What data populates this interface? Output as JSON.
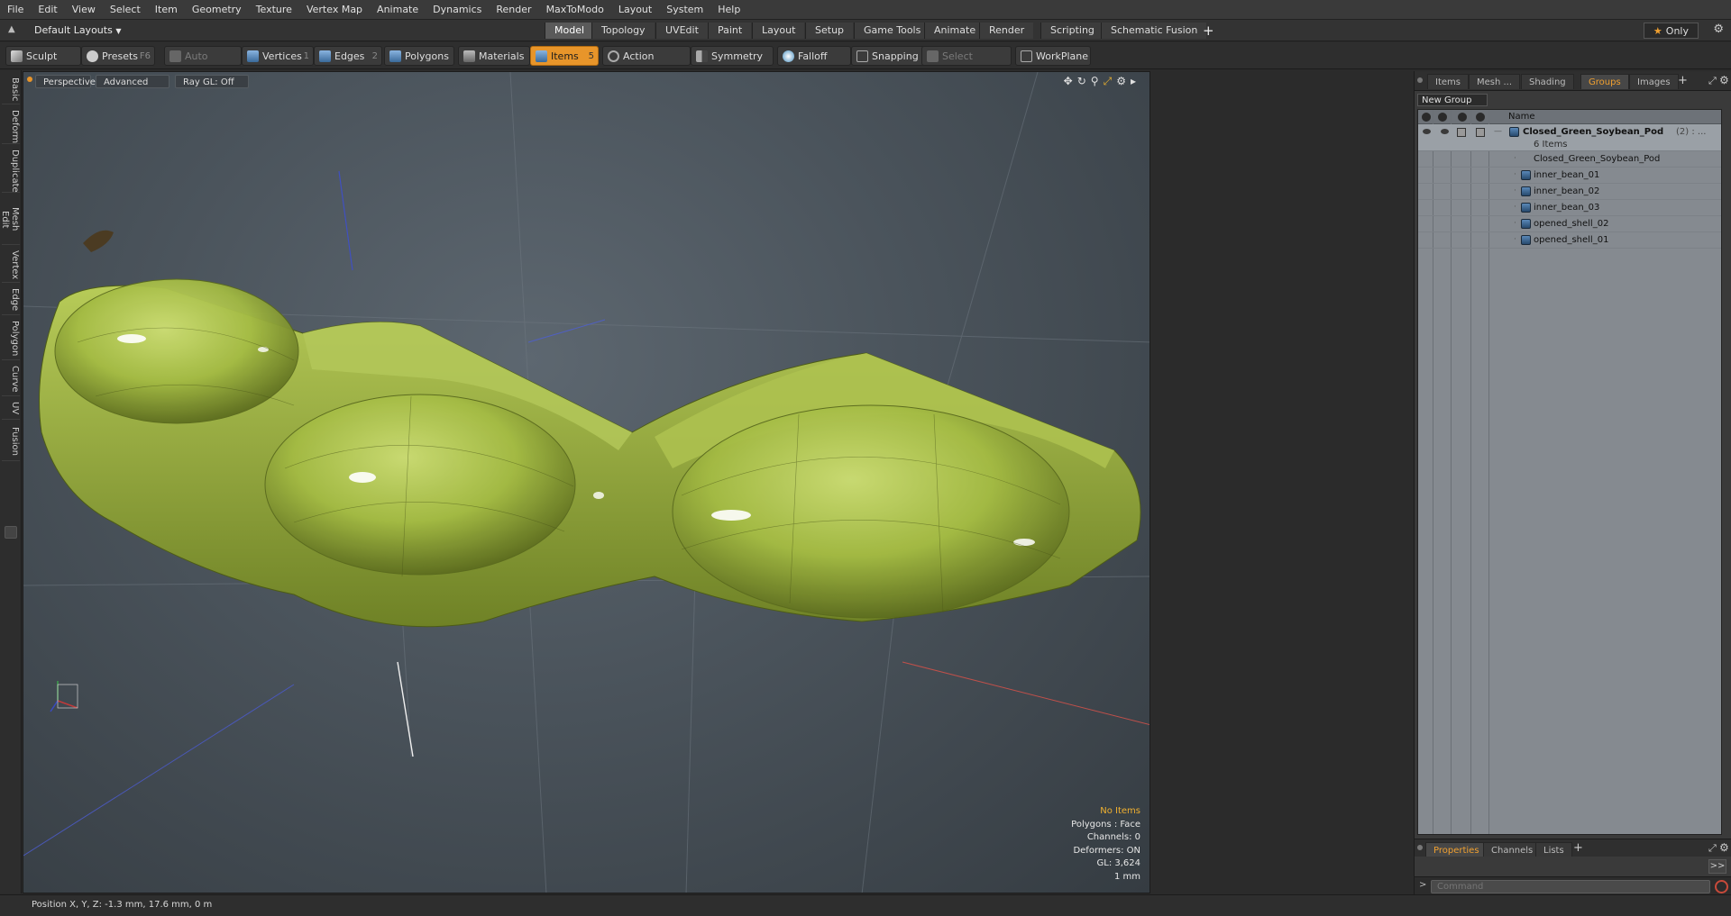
{
  "menubar": [
    "File",
    "Edit",
    "View",
    "Select",
    "Item",
    "Geometry",
    "Texture",
    "Vertex Map",
    "Animate",
    "Dynamics",
    "Render",
    "MaxToModo",
    "Layout",
    "System",
    "Help"
  ],
  "layoutbar": {
    "layout_selector": "Default Layouts",
    "tabs": [
      "Model",
      "Topology",
      "UVEdit",
      "Paint",
      "Layout",
      "Setup",
      "Game Tools",
      "Animate",
      "Render",
      "Scripting",
      "Schematic Fusion"
    ],
    "active_tab": "Model",
    "add_label": "+",
    "only_label": "Only"
  },
  "toolbar": {
    "sculpt": "Sculpt",
    "presets": "Presets",
    "presets_key": "F6",
    "auto_select": "Auto Select",
    "vertices": "Vertices",
    "vertices_key": "1",
    "edges": "Edges",
    "edges_key": "2",
    "polygons": "Polygons",
    "materials": "Materials",
    "items": "Items",
    "items_key": "5",
    "action_center": "Action Center",
    "symmetry": "Symmetry",
    "falloff": "Falloff",
    "snapping": "Snapping",
    "select_through": "Select Through",
    "workplane": "WorkPlane"
  },
  "left_tabs": [
    "Basic",
    "Deform",
    "Duplicate",
    "Mesh Edit",
    "Vertex",
    "Edge",
    "Polygon",
    "Curve",
    "UV",
    "Fusion"
  ],
  "viewport": {
    "view_mode": "Perspective",
    "shading": "Advanced",
    "raygl": "Ray GL: Off",
    "info": {
      "selection": "No Items",
      "polygons": "Polygons : Face",
      "channels": "Channels: 0",
      "deformers": "Deformers: ON",
      "gl": "GL: 3,624",
      "unit": "1 mm"
    }
  },
  "status": {
    "position": "Position X, Y, Z:  -1.3 mm, 17.6 mm, 0 m"
  },
  "right_panel": {
    "tabs": [
      "Items",
      "Mesh ...",
      "Shading",
      "Groups",
      "Images"
    ],
    "active_tab": "Groups",
    "add_label": "+",
    "new_group": "New Group",
    "column_name": "Name",
    "group": {
      "name": "Closed_Green_Soybean_Pod",
      "suffix": "(2) : ...",
      "count": "6 Items"
    },
    "items": [
      "Closed_Green_Soybean_Pod",
      "inner_bean_01",
      "inner_bean_02",
      "inner_bean_03",
      "opened_shell_02",
      "opened_shell_01"
    ],
    "bottom_tabs": [
      "Properties",
      "Channels",
      "Lists"
    ],
    "bottom_active": "Properties",
    "expand_label": ">>",
    "command_placeholder": "Command"
  },
  "colors": {
    "accent": "#f0a030",
    "items_button": "#e8952a",
    "pod_green": "#a9c13f"
  }
}
